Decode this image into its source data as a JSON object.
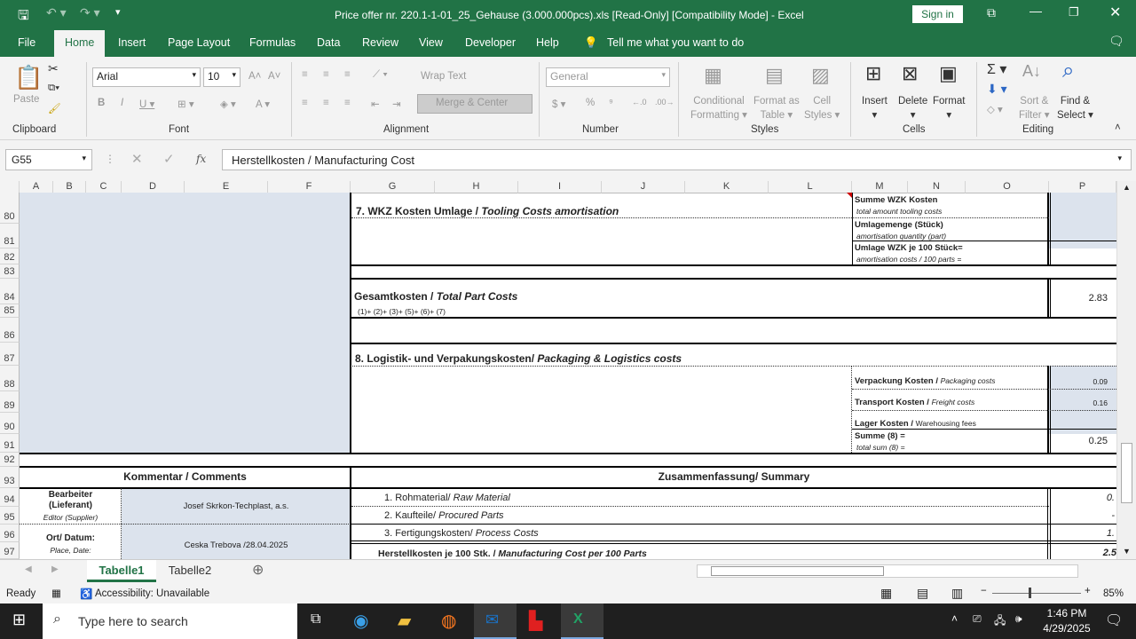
{
  "window": {
    "title": "Price offer nr. 220.1-1-01_25_Gehause (3.000.000pcs).xls  [Read-Only]  [Compatibility Mode]  -  Excel",
    "sign_in": "Sign in"
  },
  "menu": {
    "tabs": [
      "File",
      "Home",
      "Insert",
      "Page Layout",
      "Formulas",
      "Data",
      "Review",
      "View",
      "Developer",
      "Help"
    ],
    "tell_me": "Tell me what you want to do",
    "active": "Home"
  },
  "ribbon": {
    "paste": "Paste",
    "font_name": "Arial",
    "font_size": "10",
    "wrap_text": "Wrap Text",
    "merge_center": "Merge & Center",
    "number_format": "General",
    "conditional": "Conditional",
    "formatting": "Formatting",
    "format_as": "Format as",
    "table": "Table",
    "cell": "Cell",
    "styles_btn": "Styles",
    "insert": "Insert",
    "delete": "Delete",
    "format": "Format",
    "sort": "Sort &",
    "filter": "Filter",
    "find": "Find &",
    "select": "Select",
    "groups": [
      "Clipboard",
      "Font",
      "Alignment",
      "Number",
      "Styles",
      "Cells",
      "Editing"
    ]
  },
  "formula_bar": {
    "name_box": "G55",
    "fx": "fx",
    "content": "Herstellkosten / Manufacturing Cost"
  },
  "columns": [
    "A",
    "B",
    "C",
    "D",
    "E",
    "F",
    "G",
    "H",
    "I",
    "J",
    "K",
    "L",
    "M",
    "N",
    "O",
    "P"
  ],
  "rows": [
    "80",
    "81",
    "82",
    "83",
    "84",
    "85",
    "86",
    "87",
    "88",
    "89",
    "90",
    "91",
    "92",
    "93",
    "94",
    "95",
    "96",
    "97"
  ],
  "sheet": {
    "s7_title_de": "7. WKZ Kosten Umlage / ",
    "s7_title_en": "Tooling Costs amortisation",
    "summe_wzk": "Summe WZK Kosten",
    "summe_wzk_en": "total amount tooling costs",
    "umlagemenge": "Umlagemenge (Stück)",
    "umlagemenge_en": "amortisation quantity (part)",
    "umlage_100": "Umlage WZK  je 100 Stück=",
    "umlage_100_en": "amortisation costs / 100 parts =",
    "gesamt_de": "Gesamtkosten / ",
    "gesamt_en": "Total Part Costs",
    "gesamt_formula": "(1)+ (2)+ (3)+ (5)+ (6)+ (7)",
    "gesamt_value": "2.83",
    "s8_title_de": "8. Logistik- und Verpakungskosten/ ",
    "s8_title_en": "Packaging & Logistics costs",
    "verpackung": "Verpackung Kosten / ",
    "verpackung_en": "Packaging costs",
    "verpackung_value": "0.09",
    "transport": "Transport Kosten / ",
    "transport_en": "Freight costs",
    "transport_value": "0.16",
    "lager": "Lager Kosten / ",
    "lager_en": "Warehousing fees",
    "summe8": "Summe (8) =",
    "summe8_en": "total sum (8) =",
    "summe8_value": "0.25",
    "comments": "Kommentar / Comments",
    "summary": "Zusammenfassung/ Summary",
    "bearbeiter1": "Bearbeiter",
    "bearbeiter2": "(Lieferant)",
    "bearbeiter_en": "Editor (Supplier)",
    "bearbeiter_value": "Josef Skrkon-Techplast, a.s.",
    "ort": "Ort/ Datum:",
    "ort_en": "Place, Date:",
    "ort_value": "Ceska Trebova /28.04.2025",
    "sum1": "1. Rohmaterial/ ",
    "sum1_en": "Raw Material",
    "sum1_value": "0.",
    "sum2": "2. Kaufteile/ ",
    "sum2_en": "Procured Parts",
    "sum2_value": "-",
    "sum3": "3. Fertigungskosten/ ",
    "sum3_en": "Process Costs",
    "sum3_value": "1.",
    "herst": "Herstellkosten je 100 Stk. / ",
    "herst_en": "Manufacturing Cost per 100 Parts",
    "herst_value": "2.5"
  },
  "sheet_tabs": [
    "Tabelle1",
    "Tabelle2"
  ],
  "status": {
    "ready": "Ready",
    "accessibility": "Accessibility: Unavailable",
    "zoom": "85%"
  },
  "taskbar": {
    "search": "Type here to search",
    "time": "1:46 PM",
    "date": "4/29/2025"
  },
  "colors": {
    "excel_green": "#217346",
    "input_blue": "#dce3ed"
  }
}
